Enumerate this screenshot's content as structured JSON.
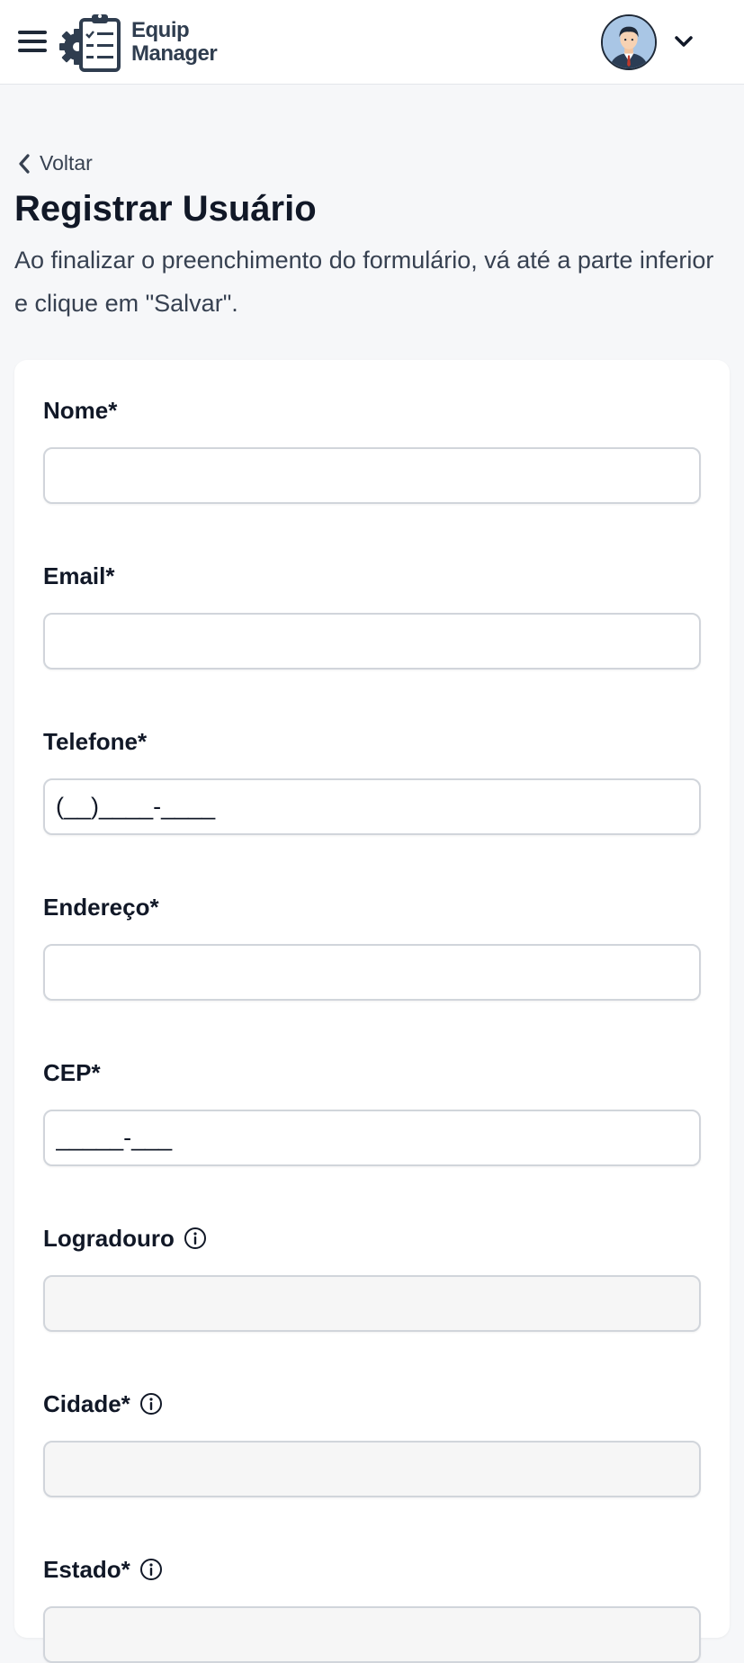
{
  "header": {
    "logo_line1": "Equip",
    "logo_line2": "Manager"
  },
  "nav": {
    "back_label": "Voltar"
  },
  "page": {
    "title": "Registrar Usuário",
    "subtitle": "Ao finalizar o preenchimento do formulário, vá até a parte inferior e clique em \"Salvar\"."
  },
  "form": {
    "nome": {
      "label": "Nome*",
      "value": ""
    },
    "email": {
      "label": "Email*",
      "value": ""
    },
    "telefone": {
      "label": "Telefone*",
      "value": "(__)____-____"
    },
    "endereco": {
      "label": "Endereço*",
      "value": ""
    },
    "cep": {
      "label": "CEP*",
      "value": "_____-___"
    },
    "logradouro": {
      "label": "Logradouro",
      "value": ""
    },
    "cidade": {
      "label": "Cidade*",
      "value": ""
    },
    "estado": {
      "label": "Estado*",
      "value": ""
    }
  },
  "colors": {
    "background": "#f6f7f9",
    "card": "#ffffff",
    "text": "#111827",
    "border": "#d1d5db",
    "disabled_field": "#f6f6f6"
  },
  "icons": [
    "menu-icon",
    "clipboard-gear-logo",
    "user-avatar",
    "chevron-down-icon",
    "chevron-left-icon",
    "info-icon"
  ]
}
